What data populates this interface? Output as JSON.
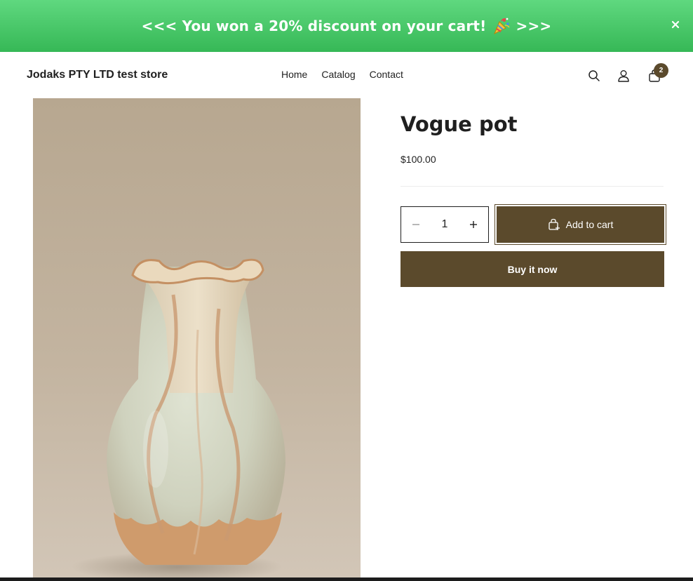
{
  "banner": {
    "text": "<<< You won a 20% discount on your cart! 🎉 >>>",
    "text_before": "<<< You won a 20% discount on your cart!",
    "text_after": ">>>",
    "emoji_icon": "party-popper-icon",
    "close_icon": "close-icon",
    "background": "#42c463"
  },
  "header": {
    "store_name": "Jodaks PTY LTD test store",
    "nav": [
      "Home",
      "Catalog",
      "Contact"
    ],
    "icons": [
      "search-icon",
      "account-icon",
      "cart-icon"
    ],
    "cart_count": "2"
  },
  "product": {
    "title": "Vogue pot",
    "price": "$100.00",
    "image_icon": "vase-image",
    "quantity": "1",
    "add_to_cart_label": "Add to cart",
    "buy_now_label": "Buy it now"
  },
  "colors": {
    "accent": "#5b4a2c",
    "banner_green": "#42c463",
    "text": "#1f1f1f"
  }
}
